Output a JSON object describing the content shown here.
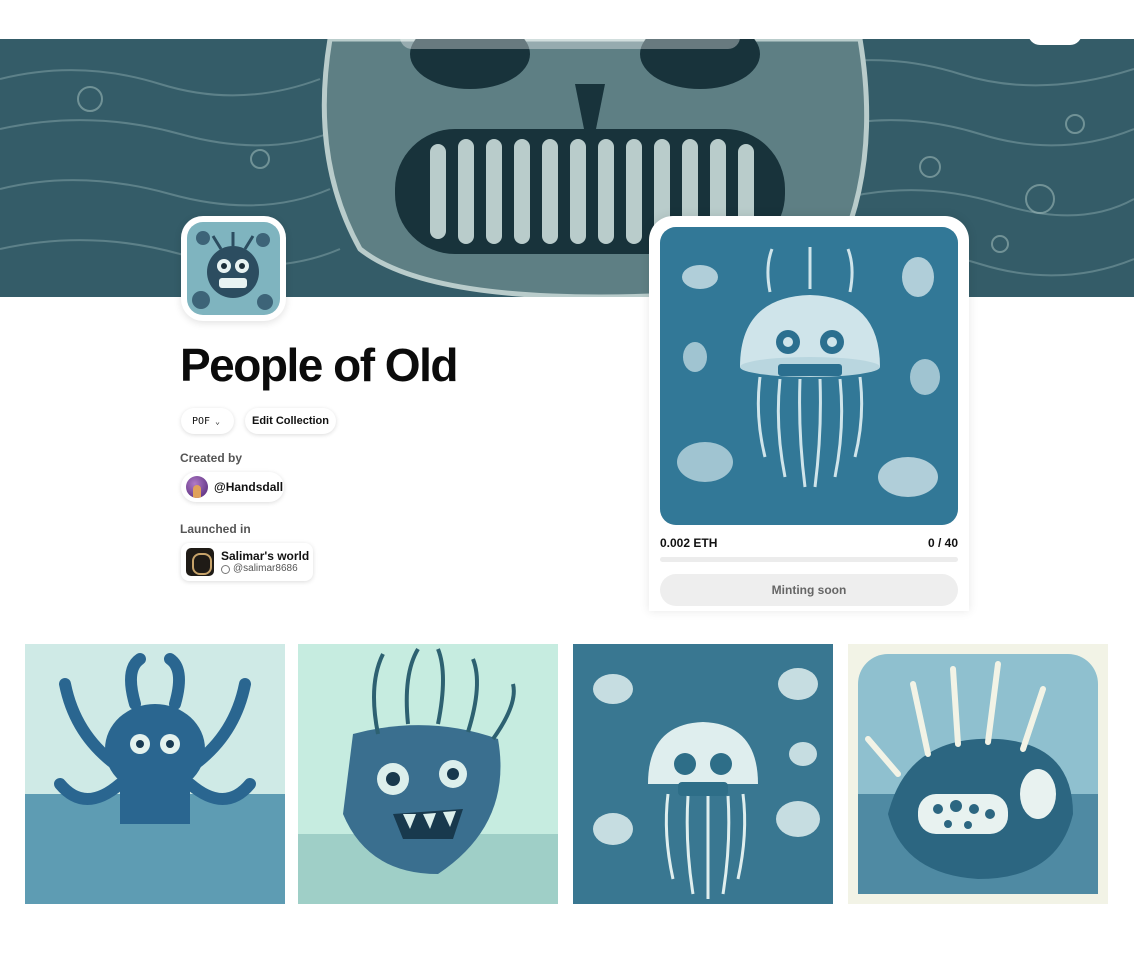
{
  "collection": {
    "title": "People of Old",
    "symbol": "POF",
    "edit_label": "Edit Collection"
  },
  "creator": {
    "label": "Created by",
    "handle": "@Handsdall"
  },
  "launch": {
    "label": "Launched in",
    "world_name": "Salimar's world",
    "world_handle": "@salimar8686"
  },
  "mint": {
    "price": "0.002 ETH",
    "supply": "0 / 40",
    "minted_fraction": 0,
    "button_label": "Minting soon"
  },
  "gallery": [
    {
      "subject": "octopus-creature"
    },
    {
      "subject": "pot-creature"
    },
    {
      "subject": "jellyfish-skulls"
    },
    {
      "subject": "shell-creature"
    }
  ],
  "colors": {
    "banner": "#2f5560",
    "art_teal": "#2b6f8f",
    "art_light": "#d8efe9",
    "button_bg": "#eeeeee"
  }
}
